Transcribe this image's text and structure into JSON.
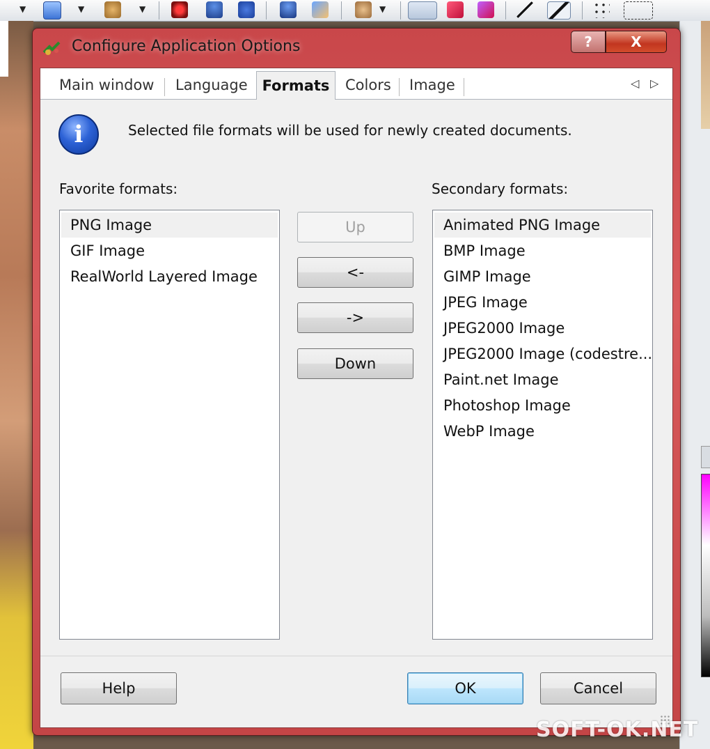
{
  "window": {
    "title": "Configure Application Options",
    "help_button": "?",
    "close_button": "X"
  },
  "tabs": [
    {
      "label": "Main window",
      "active": false
    },
    {
      "label": "Language",
      "active": false
    },
    {
      "label": "Formats",
      "active": true
    },
    {
      "label": "Colors",
      "active": false
    },
    {
      "label": "Image",
      "active": false
    }
  ],
  "tab_scroll": {
    "left": "◁",
    "right": "▷"
  },
  "info": {
    "icon_glyph": "i",
    "text": "Selected file formats will be used for newly created documents."
  },
  "favorite": {
    "label": "Favorite formats:",
    "items": [
      "PNG Image",
      "GIF Image",
      "RealWorld Layered Image"
    ],
    "selected": "PNG Image"
  },
  "secondary": {
    "label": "Secondary formats:",
    "items": [
      "Animated PNG Image",
      "BMP Image",
      "GIMP Image",
      "JPEG Image",
      "JPEG2000 Image",
      "JPEG2000 Image (codestre...",
      "Paint.net Image",
      "Photoshop Image",
      "WebP Image"
    ],
    "selected": "Animated PNG Image"
  },
  "move_buttons": {
    "up": "Up",
    "to_favorite": "<-",
    "to_secondary": "->",
    "down": "Down"
  },
  "footer": {
    "help": "Help",
    "ok": "OK",
    "cancel": "Cancel"
  },
  "watermark": "SOFT-OK.NET",
  "colors": {
    "frame": "#c9474a",
    "default_button_border": "#3c7fb1",
    "info_icon": "#2d62d6"
  }
}
